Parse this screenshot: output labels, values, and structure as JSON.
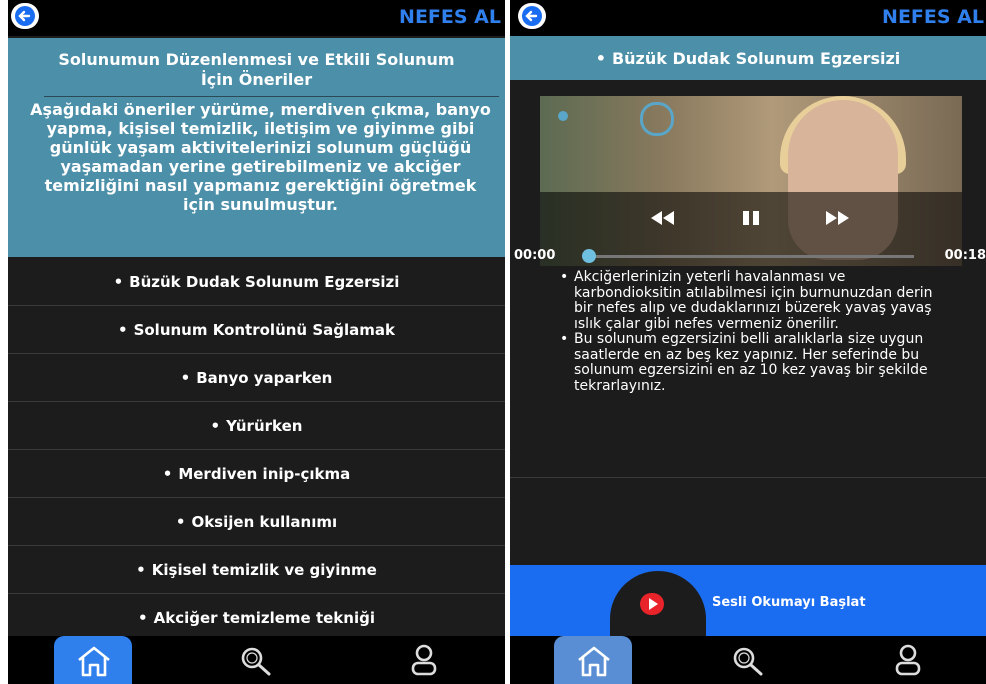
{
  "app": {
    "title": "NEFES AL"
  },
  "left": {
    "info_title": "Solunumun Düzenlenmesi ve Etkili Solunum İçin Öneriler",
    "info_body": "Aşağıdaki öneriler yürüme, merdiven çıkma, banyo yapma, kişisel temizlik, iletişim ve giyinme gibi günlük yaşam aktivitelerinizi solunum güçlüğü yaşamadan yerine getirebilmeniz ve akciğer temizliğini nasıl yapmanız gerektiğini öğretmek için sunulmuştur.",
    "menu": [
      "Büzük Dudak Solunum Egzersizi",
      "Solunum Kontrolünü Sağlamak",
      "Banyo yaparken",
      "Yürürken",
      "Merdiven inip-çıkma",
      "Oksijen kullanımı",
      "Kişisel temizlik ve giyinme",
      "Akciğer temizleme tekniği"
    ]
  },
  "right": {
    "section_title": "Büzük Dudak Solunum Egzersizi",
    "video": {
      "current_time": "00:00",
      "duration": "00:18",
      "progress": 0
    },
    "bullets": [
      "Akciğerlerinizin yeterli havalanması ve karbondioksitin atılabilmesi için burnunuzdan derin bir nefes alıp ve dudaklarınızı büzerek yavaş yavaş ıslık çalar gibi nefes vermeniz önerilir.",
      "Bu solunum egzersizini belli aralıklarla size uygun saatlerde en az beş kez yapınız. Her seferinde bu solunum egzersizini en az 10 kez yavaş bir şekilde tekrarlayınız."
    ],
    "audio_button": "Sesli Okumayı Başlat"
  },
  "colors": {
    "accent": "#2f80ed",
    "panel": "#4b8fa8",
    "audio_bar": "#1a6cf0",
    "background": "#1c1c1c"
  },
  "icons": [
    "back-arrow-icon",
    "rewind-icon",
    "pause-icon",
    "fast-forward-icon",
    "youtube-play-icon",
    "home-icon",
    "search-icon",
    "profile-icon"
  ]
}
